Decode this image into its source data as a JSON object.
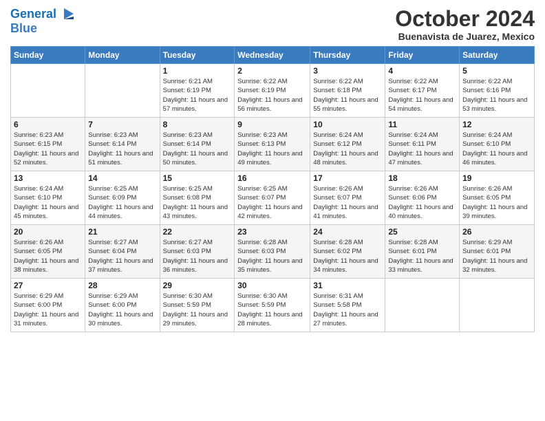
{
  "header": {
    "logo_line1": "General",
    "logo_line2": "Blue",
    "month_title": "October 2024",
    "location": "Buenavista de Juarez, Mexico"
  },
  "days_of_week": [
    "Sunday",
    "Monday",
    "Tuesday",
    "Wednesday",
    "Thursday",
    "Friday",
    "Saturday"
  ],
  "weeks": [
    [
      {
        "day": "",
        "sunrise": "",
        "sunset": "",
        "daylight": ""
      },
      {
        "day": "",
        "sunrise": "",
        "sunset": "",
        "daylight": ""
      },
      {
        "day": "1",
        "sunrise": "Sunrise: 6:21 AM",
        "sunset": "Sunset: 6:19 PM",
        "daylight": "Daylight: 11 hours and 57 minutes."
      },
      {
        "day": "2",
        "sunrise": "Sunrise: 6:22 AM",
        "sunset": "Sunset: 6:19 PM",
        "daylight": "Daylight: 11 hours and 56 minutes."
      },
      {
        "day": "3",
        "sunrise": "Sunrise: 6:22 AM",
        "sunset": "Sunset: 6:18 PM",
        "daylight": "Daylight: 11 hours and 55 minutes."
      },
      {
        "day": "4",
        "sunrise": "Sunrise: 6:22 AM",
        "sunset": "Sunset: 6:17 PM",
        "daylight": "Daylight: 11 hours and 54 minutes."
      },
      {
        "day": "5",
        "sunrise": "Sunrise: 6:22 AM",
        "sunset": "Sunset: 6:16 PM",
        "daylight": "Daylight: 11 hours and 53 minutes."
      }
    ],
    [
      {
        "day": "6",
        "sunrise": "Sunrise: 6:23 AM",
        "sunset": "Sunset: 6:15 PM",
        "daylight": "Daylight: 11 hours and 52 minutes."
      },
      {
        "day": "7",
        "sunrise": "Sunrise: 6:23 AM",
        "sunset": "Sunset: 6:14 PM",
        "daylight": "Daylight: 11 hours and 51 minutes."
      },
      {
        "day": "8",
        "sunrise": "Sunrise: 6:23 AM",
        "sunset": "Sunset: 6:14 PM",
        "daylight": "Daylight: 11 hours and 50 minutes."
      },
      {
        "day": "9",
        "sunrise": "Sunrise: 6:23 AM",
        "sunset": "Sunset: 6:13 PM",
        "daylight": "Daylight: 11 hours and 49 minutes."
      },
      {
        "day": "10",
        "sunrise": "Sunrise: 6:24 AM",
        "sunset": "Sunset: 6:12 PM",
        "daylight": "Daylight: 11 hours and 48 minutes."
      },
      {
        "day": "11",
        "sunrise": "Sunrise: 6:24 AM",
        "sunset": "Sunset: 6:11 PM",
        "daylight": "Daylight: 11 hours and 47 minutes."
      },
      {
        "day": "12",
        "sunrise": "Sunrise: 6:24 AM",
        "sunset": "Sunset: 6:10 PM",
        "daylight": "Daylight: 11 hours and 46 minutes."
      }
    ],
    [
      {
        "day": "13",
        "sunrise": "Sunrise: 6:24 AM",
        "sunset": "Sunset: 6:10 PM",
        "daylight": "Daylight: 11 hours and 45 minutes."
      },
      {
        "day": "14",
        "sunrise": "Sunrise: 6:25 AM",
        "sunset": "Sunset: 6:09 PM",
        "daylight": "Daylight: 11 hours and 44 minutes."
      },
      {
        "day": "15",
        "sunrise": "Sunrise: 6:25 AM",
        "sunset": "Sunset: 6:08 PM",
        "daylight": "Daylight: 11 hours and 43 minutes."
      },
      {
        "day": "16",
        "sunrise": "Sunrise: 6:25 AM",
        "sunset": "Sunset: 6:07 PM",
        "daylight": "Daylight: 11 hours and 42 minutes."
      },
      {
        "day": "17",
        "sunrise": "Sunrise: 6:26 AM",
        "sunset": "Sunset: 6:07 PM",
        "daylight": "Daylight: 11 hours and 41 minutes."
      },
      {
        "day": "18",
        "sunrise": "Sunrise: 6:26 AM",
        "sunset": "Sunset: 6:06 PM",
        "daylight": "Daylight: 11 hours and 40 minutes."
      },
      {
        "day": "19",
        "sunrise": "Sunrise: 6:26 AM",
        "sunset": "Sunset: 6:05 PM",
        "daylight": "Daylight: 11 hours and 39 minutes."
      }
    ],
    [
      {
        "day": "20",
        "sunrise": "Sunrise: 6:26 AM",
        "sunset": "Sunset: 6:05 PM",
        "daylight": "Daylight: 11 hours and 38 minutes."
      },
      {
        "day": "21",
        "sunrise": "Sunrise: 6:27 AM",
        "sunset": "Sunset: 6:04 PM",
        "daylight": "Daylight: 11 hours and 37 minutes."
      },
      {
        "day": "22",
        "sunrise": "Sunrise: 6:27 AM",
        "sunset": "Sunset: 6:03 PM",
        "daylight": "Daylight: 11 hours and 36 minutes."
      },
      {
        "day": "23",
        "sunrise": "Sunrise: 6:28 AM",
        "sunset": "Sunset: 6:03 PM",
        "daylight": "Daylight: 11 hours and 35 minutes."
      },
      {
        "day": "24",
        "sunrise": "Sunrise: 6:28 AM",
        "sunset": "Sunset: 6:02 PM",
        "daylight": "Daylight: 11 hours and 34 minutes."
      },
      {
        "day": "25",
        "sunrise": "Sunrise: 6:28 AM",
        "sunset": "Sunset: 6:01 PM",
        "daylight": "Daylight: 11 hours and 33 minutes."
      },
      {
        "day": "26",
        "sunrise": "Sunrise: 6:29 AM",
        "sunset": "Sunset: 6:01 PM",
        "daylight": "Daylight: 11 hours and 32 minutes."
      }
    ],
    [
      {
        "day": "27",
        "sunrise": "Sunrise: 6:29 AM",
        "sunset": "Sunset: 6:00 PM",
        "daylight": "Daylight: 11 hours and 31 minutes."
      },
      {
        "day": "28",
        "sunrise": "Sunrise: 6:29 AM",
        "sunset": "Sunset: 6:00 PM",
        "daylight": "Daylight: 11 hours and 30 minutes."
      },
      {
        "day": "29",
        "sunrise": "Sunrise: 6:30 AM",
        "sunset": "Sunset: 5:59 PM",
        "daylight": "Daylight: 11 hours and 29 minutes."
      },
      {
        "day": "30",
        "sunrise": "Sunrise: 6:30 AM",
        "sunset": "Sunset: 5:59 PM",
        "daylight": "Daylight: 11 hours and 28 minutes."
      },
      {
        "day": "31",
        "sunrise": "Sunrise: 6:31 AM",
        "sunset": "Sunset: 5:58 PM",
        "daylight": "Daylight: 11 hours and 27 minutes."
      },
      {
        "day": "",
        "sunrise": "",
        "sunset": "",
        "daylight": ""
      },
      {
        "day": "",
        "sunrise": "",
        "sunset": "",
        "daylight": ""
      }
    ]
  ]
}
